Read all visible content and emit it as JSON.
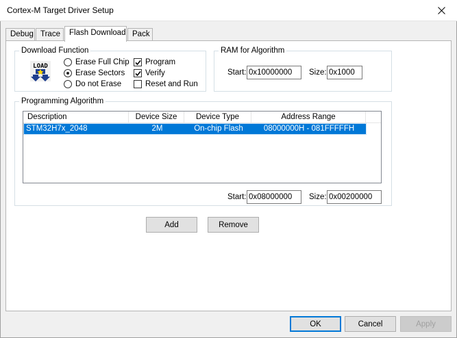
{
  "window": {
    "title": "Cortex-M Target Driver Setup"
  },
  "tabs": [
    {
      "label": "Debug"
    },
    {
      "label": "Trace"
    },
    {
      "label": "Flash Download"
    },
    {
      "label": "Pack"
    }
  ],
  "download_function": {
    "title": "Download Function",
    "icon_text": "LOAD",
    "radios": [
      {
        "label": "Erase Full Chip",
        "selected": false
      },
      {
        "label": "Erase Sectors",
        "selected": true
      },
      {
        "label": "Do not Erase",
        "selected": false
      }
    ],
    "checks": [
      {
        "label": "Program",
        "checked": true
      },
      {
        "label": "Verify",
        "checked": true
      },
      {
        "label": "Reset and Run",
        "checked": false
      }
    ]
  },
  "ram_for_algorithm": {
    "title": "RAM for Algorithm",
    "start_label": "Start:",
    "start_value": "0x10000000",
    "size_label": "Size:",
    "size_value": "0x1000"
  },
  "programming_algorithm": {
    "title": "Programming Algorithm",
    "columns": [
      "Description",
      "Device Size",
      "Device Type",
      "Address Range"
    ],
    "rows": [
      {
        "description": "STM32H7x_2048",
        "device_size": "2M",
        "device_type": "On-chip Flash",
        "address_range": "08000000H - 081FFFFFH"
      }
    ],
    "start_label": "Start:",
    "start_value": "0x08000000",
    "size_label": "Size:",
    "size_value": "0x00200000",
    "add_label": "Add",
    "remove_label": "Remove"
  },
  "footer": {
    "ok_label": "OK",
    "cancel_label": "Cancel",
    "apply_label": "Apply"
  },
  "colors": {
    "selection": "#0078d7",
    "default_button_border": "#0078d7"
  }
}
